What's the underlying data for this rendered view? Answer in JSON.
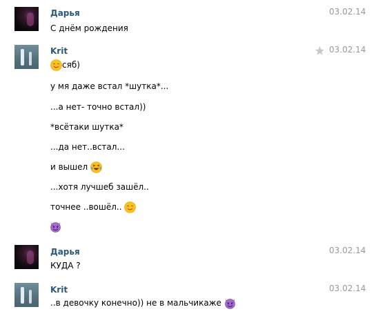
{
  "messages": [
    {
      "author": "Дарья",
      "date": "03.02.14",
      "lines": [
        "С днём рождения"
      ]
    },
    {
      "author": "Krit",
      "date": "03.02.14",
      "lines": [
        "сяб)",
        "у мя даже встал *шутка*...",
        "...а нет- точно встал))",
        "*всётаки шутка*",
        "...да нет..встал...",
        "и вышел",
        "...хотя лучшеб зашёл..",
        "точнее ..вошёл.."
      ]
    },
    {
      "author": "Дарья",
      "date": "03.02.14",
      "lines": [
        "КУДА ?"
      ]
    },
    {
      "author": "Krit",
      "date": "03.02.14",
      "lines": [
        "..в девочку конечно)) не в мальчикаже"
      ]
    }
  ],
  "icons": {
    "star": "star-icon",
    "smile": "smiling-face-emoji",
    "laugh": "tears-of-joy-emoji",
    "devil": "smiling-devil-emoji"
  },
  "colors": {
    "author": "#2b587a",
    "date": "#999999",
    "star": "#c8c8c8"
  }
}
